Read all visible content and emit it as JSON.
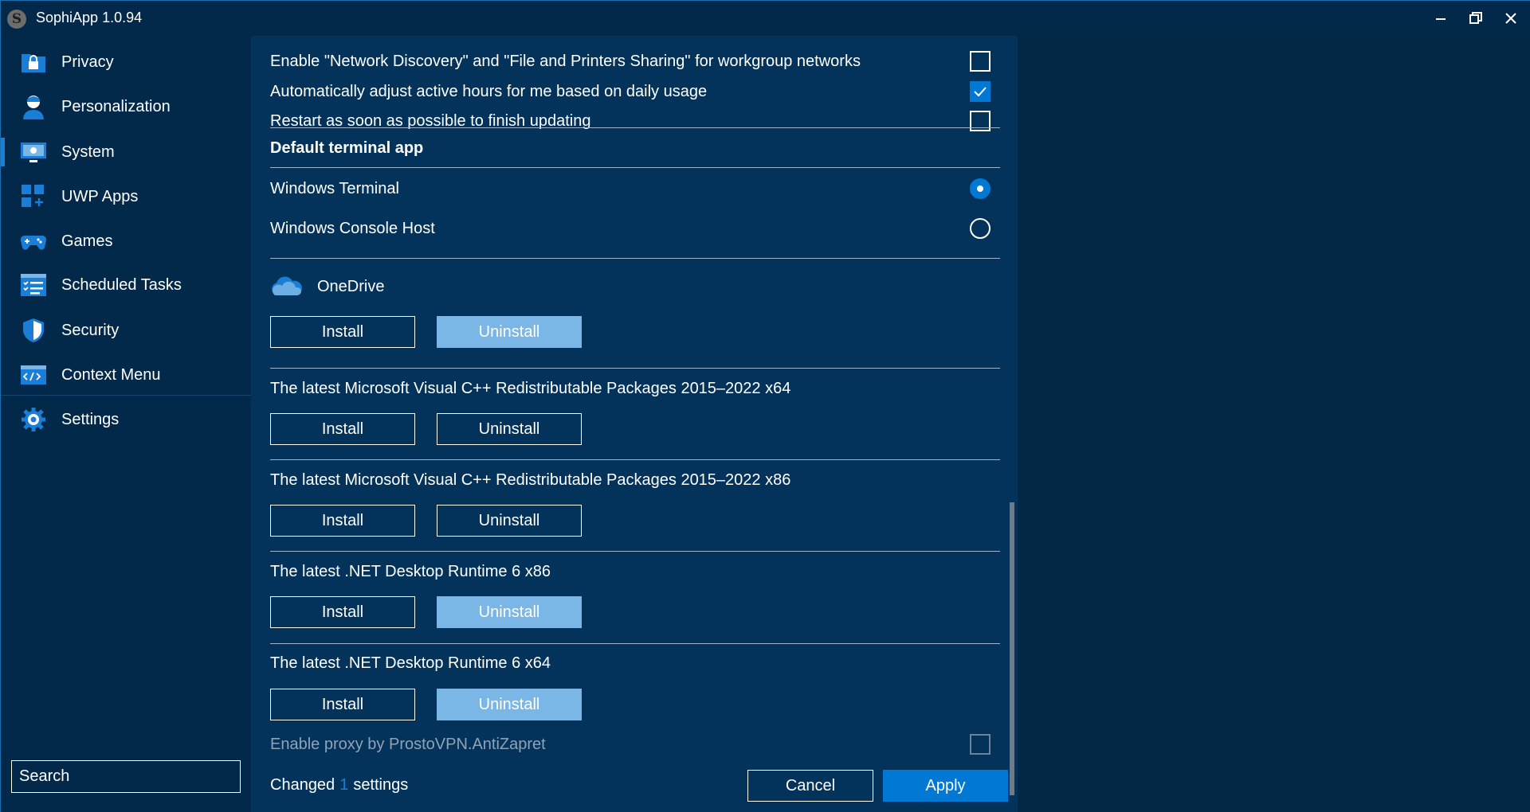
{
  "window": {
    "title": "SophiApp 1.0.94",
    "logo_letter": "S",
    "minimize_icon": "minimize-icon",
    "restore_icon": "restore-icon",
    "close_icon": "close-icon"
  },
  "sidebar": {
    "items": [
      {
        "label": "Privacy",
        "icon": "lock-folder-icon"
      },
      {
        "label": "Personalization",
        "icon": "person-icon"
      },
      {
        "label": "System",
        "icon": "monitor-icon",
        "active": true
      },
      {
        "label": "UWP Apps",
        "icon": "apps-grid-icon"
      },
      {
        "label": "Games",
        "icon": "gamepad-icon"
      },
      {
        "label": "Scheduled Tasks",
        "icon": "checklist-icon"
      },
      {
        "label": "Security",
        "icon": "shield-icon"
      },
      {
        "label": "Context Menu",
        "icon": "code-window-icon"
      },
      {
        "label": "Settings",
        "icon": "gear-icon"
      }
    ],
    "search_placeholder": "Search"
  },
  "main": {
    "settings_top": [
      {
        "label": "Enable \"Network Discovery\" and \"File and Printers Sharing\" for workgroup networks",
        "checked": false
      },
      {
        "label": "Automatically adjust active hours for me based on daily usage",
        "checked": true
      },
      {
        "label": "Restart as soon as possible to finish updating",
        "checked": false
      }
    ],
    "terminal_section": {
      "title": "Default terminal app",
      "options": [
        {
          "label": "Windows Terminal",
          "selected": true
        },
        {
          "label": "Windows Console Host",
          "selected": false
        }
      ]
    },
    "packages": [
      {
        "title": "OneDrive",
        "icon": "onedrive-cloud-icon",
        "install_label": "Install",
        "uninstall_label": "Uninstall",
        "uninstall_disabled": true
      },
      {
        "title": "The latest Microsoft Visual C++ Redistributable Packages 2015–2022 x64",
        "install_label": "Install",
        "uninstall_label": "Uninstall",
        "uninstall_disabled": false
      },
      {
        "title": "The latest Microsoft Visual C++ Redistributable Packages 2015–2022 x86",
        "install_label": "Install",
        "uninstall_label": "Uninstall",
        "uninstall_disabled": false
      },
      {
        "title": "The latest .NET Desktop Runtime 6 x86",
        "install_label": "Install",
        "uninstall_label": "Uninstall",
        "uninstall_disabled": true
      },
      {
        "title": "The latest .NET Desktop Runtime 6 x64",
        "install_label": "Install",
        "uninstall_label": "Uninstall",
        "uninstall_disabled": true
      }
    ],
    "proxy_setting": {
      "label": "Enable proxy by ProstoVPN.AntiZapret",
      "checked": false,
      "disabled": true
    }
  },
  "footer": {
    "changed_prefix": "Changed",
    "changed_count": "1",
    "changed_suffix": "settings",
    "cancel_label": "Cancel",
    "apply_label": "Apply"
  },
  "colors": {
    "background": "#03335a",
    "sidebar": "#03294a",
    "accent": "#0078d4",
    "disabled_button": "#7bb7e6"
  }
}
